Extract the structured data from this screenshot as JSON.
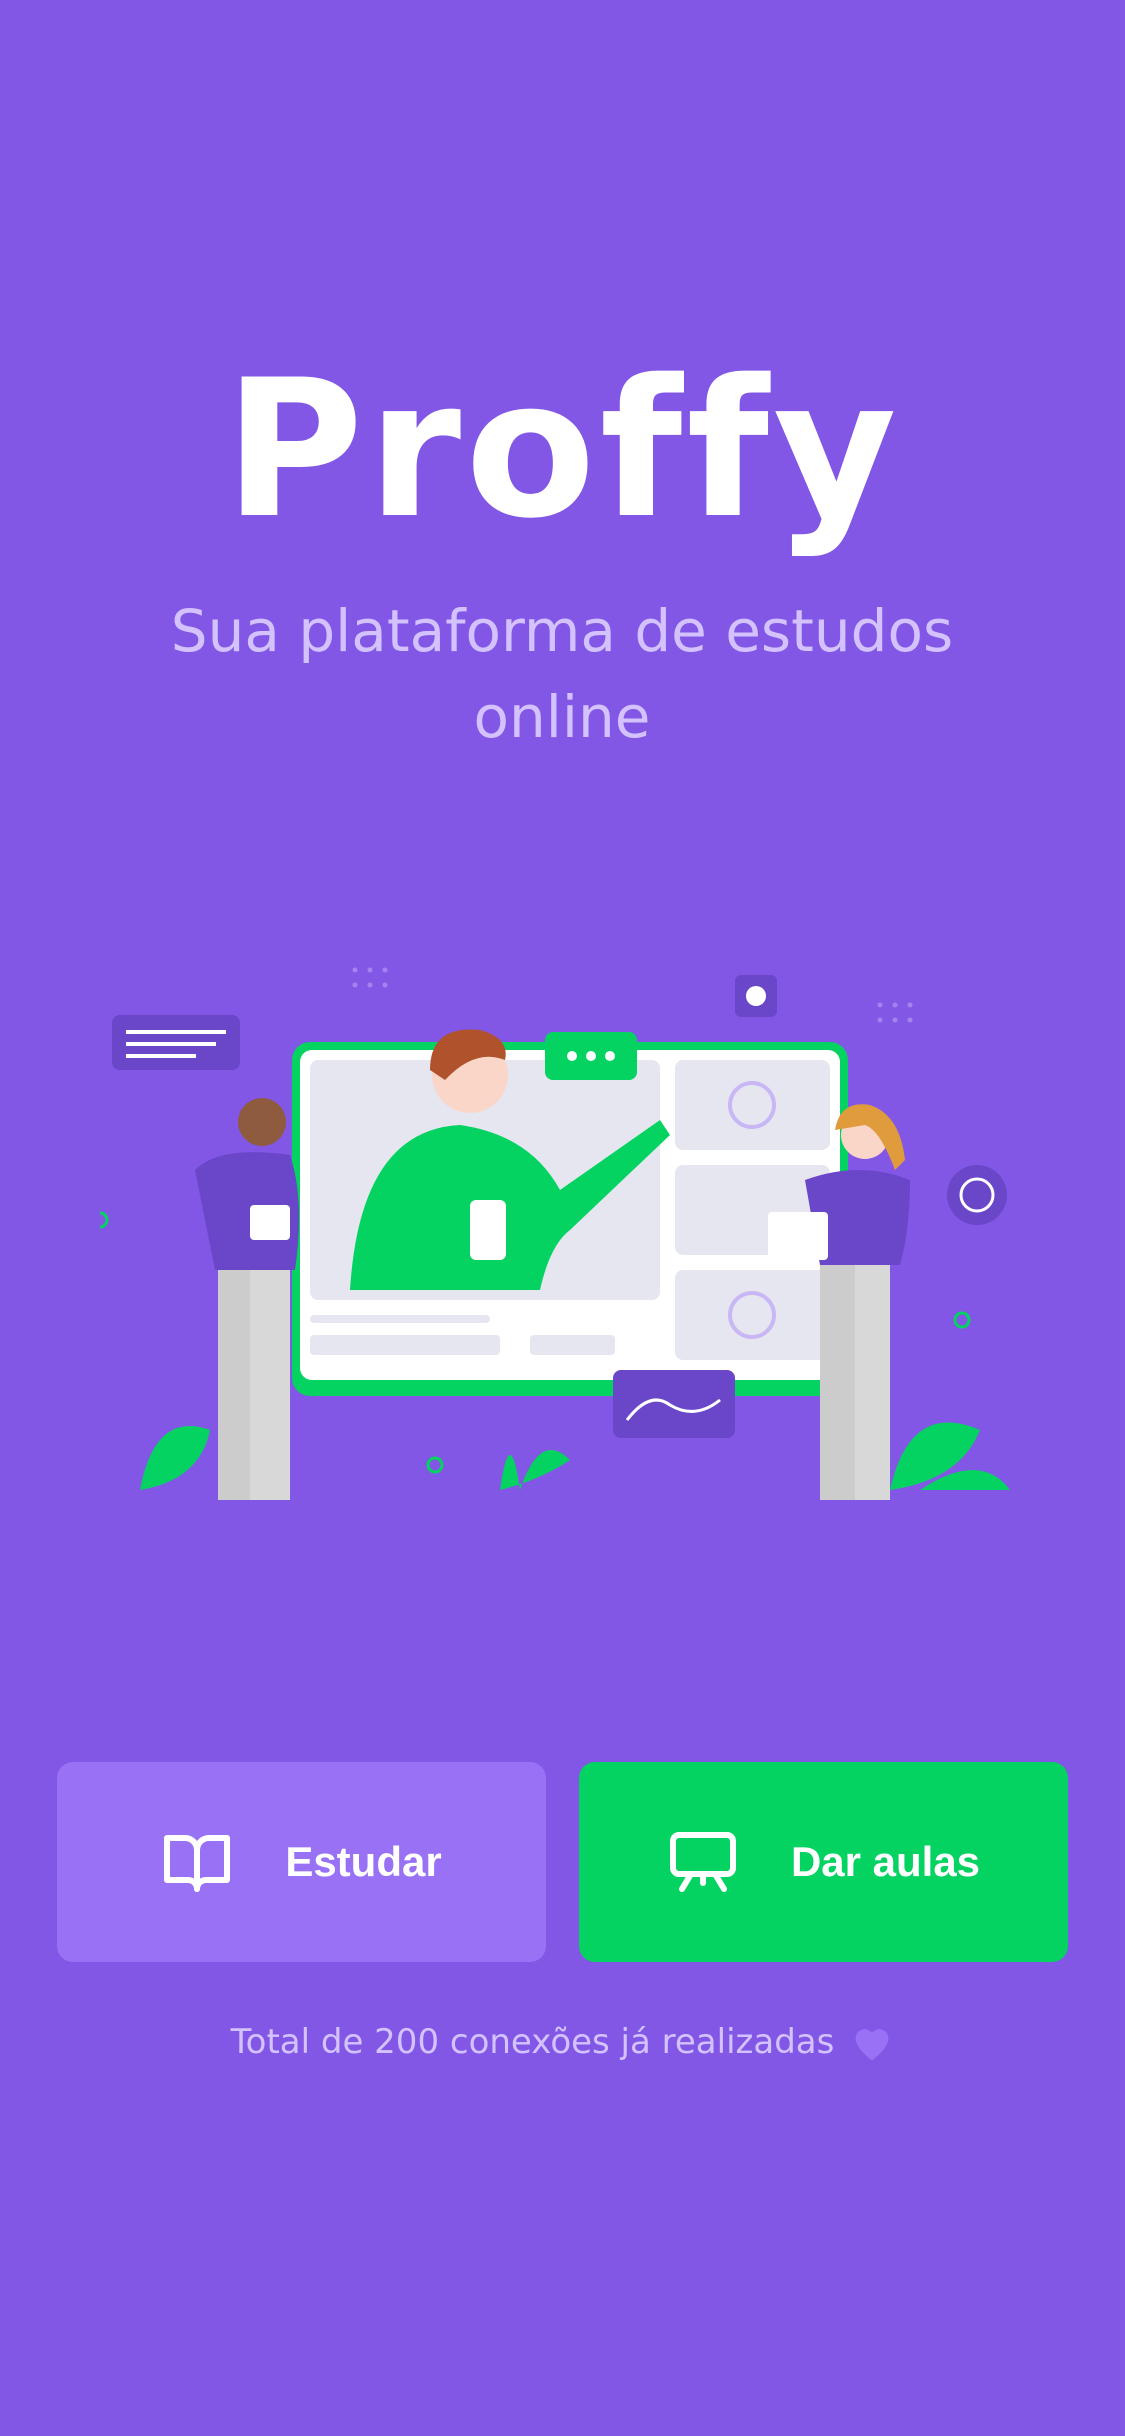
{
  "app": {
    "logo": "Proffy",
    "subtitle_line1": "Sua plataforma de estudos",
    "subtitle_line2": "online"
  },
  "colors": {
    "background": "#8257E5",
    "study_button": "#9871F5",
    "teach_button": "#04D361",
    "subtitle_text": "#D4C2FF"
  },
  "hero": {
    "icon": "landing-illustration"
  },
  "buttons": {
    "study": {
      "label": "Estudar",
      "icon": "book-open-icon"
    },
    "teach": {
      "label": "Dar aulas",
      "icon": "presentation-icon"
    }
  },
  "footer": {
    "text": "Total de 200 conexões já realizadas",
    "icon": "heart-icon"
  }
}
